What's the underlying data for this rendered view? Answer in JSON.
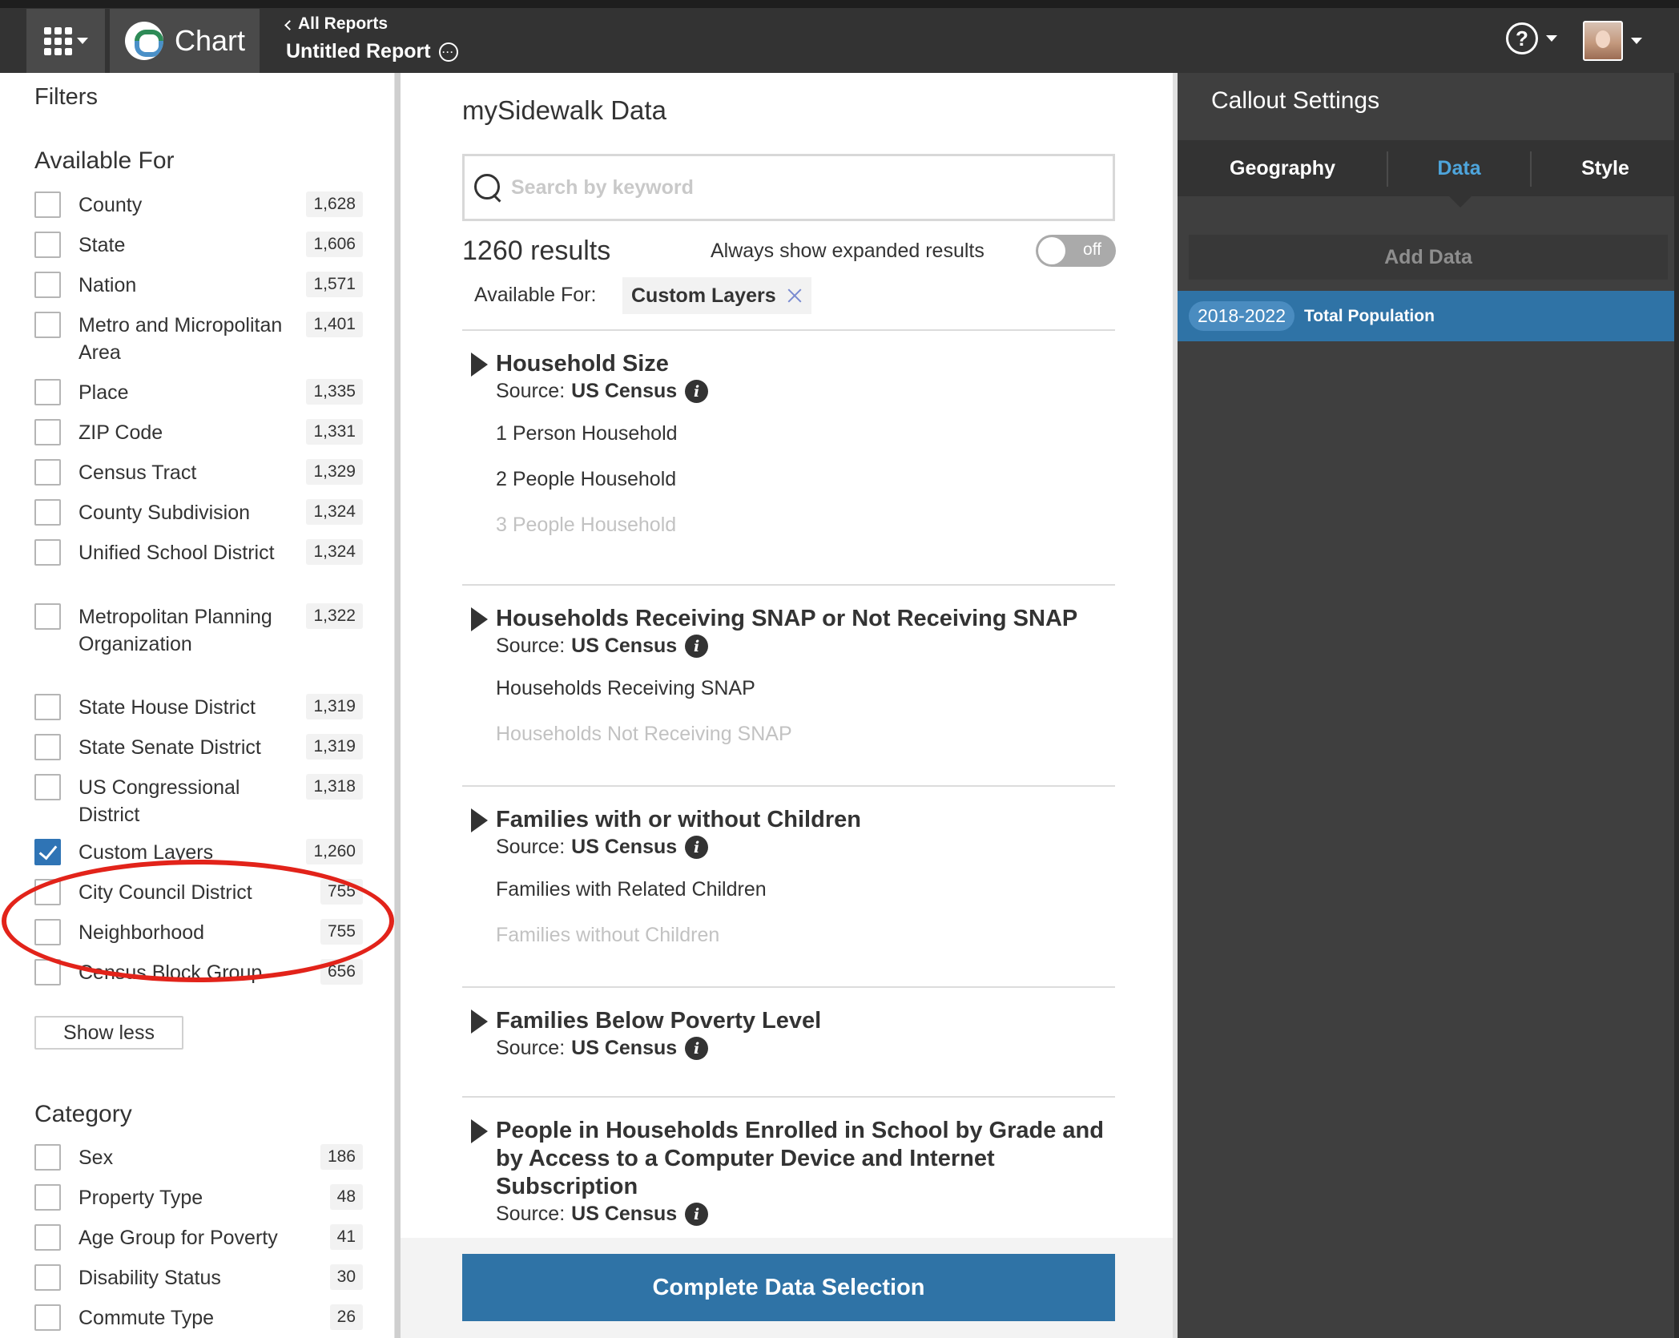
{
  "topbar": {
    "app_name": "Chart",
    "back_link": "All Reports",
    "report_title": "Untitled Report"
  },
  "filters": {
    "title": "Filters",
    "available_for_title": "Available For",
    "available_for": [
      {
        "label": "County",
        "count": "1,628",
        "checked": false
      },
      {
        "label": "State",
        "count": "1,606",
        "checked": false
      },
      {
        "label": "Nation",
        "count": "1,571",
        "checked": false
      },
      {
        "label": "Metro and Micropolitan Area",
        "count": "1,401",
        "checked": false
      },
      {
        "label": "Place",
        "count": "1,335",
        "checked": false
      },
      {
        "label": "ZIP Code",
        "count": "1,331",
        "checked": false
      },
      {
        "label": "Census Tract",
        "count": "1,329",
        "checked": false
      },
      {
        "label": "County Subdivision",
        "count": "1,324",
        "checked": false
      },
      {
        "label": "Unified School District",
        "count": "1,324",
        "checked": false
      },
      {
        "label": "Metropolitan Planning Organization",
        "count": "1,322",
        "checked": false
      },
      {
        "label": "State House District",
        "count": "1,319",
        "checked": false
      },
      {
        "label": "State Senate District",
        "count": "1,319",
        "checked": false
      },
      {
        "label": "US Congressional District",
        "count": "1,318",
        "checked": false
      },
      {
        "label": "Custom Layers",
        "count": "1,260",
        "checked": true
      },
      {
        "label": "City Council District",
        "count": "755",
        "checked": false
      },
      {
        "label": "Neighborhood",
        "count": "755",
        "checked": false
      },
      {
        "label": "Census Block Group",
        "count": "656",
        "checked": false
      }
    ],
    "show_less_label": "Show less",
    "category_title": "Category",
    "category": [
      {
        "label": "Sex",
        "count": "186",
        "checked": false
      },
      {
        "label": "Property Type",
        "count": "48",
        "checked": false
      },
      {
        "label": "Age Group for Poverty",
        "count": "41",
        "checked": false
      },
      {
        "label": "Disability Status",
        "count": "30",
        "checked": false
      },
      {
        "label": "Commute Type",
        "count": "26",
        "checked": false
      }
    ]
  },
  "center": {
    "title": "mySidewalk Data",
    "search_placeholder": "Search by keyword",
    "results_count": "1260 results",
    "expand_label": "Always show expanded results",
    "toggle_state": "off",
    "available_for_label": "Available For:",
    "active_filter_chip": "Custom Layers",
    "source_label": "Source:",
    "groups": [
      {
        "title": "Household Size",
        "source": "US Census",
        "items": [
          {
            "label": "1 Person Household",
            "faded": false
          },
          {
            "label": "2 People Household",
            "faded": false
          },
          {
            "label": "3 People Household",
            "faded": true
          }
        ]
      },
      {
        "title": "Households Receiving SNAP or Not Receiving SNAP",
        "source": "US Census",
        "items": [
          {
            "label": "Households Receiving SNAP",
            "faded": false
          },
          {
            "label": "Households Not Receiving SNAP",
            "faded": true
          }
        ]
      },
      {
        "title": "Families with or without Children",
        "source": "US Census",
        "items": [
          {
            "label": "Families with Related Children",
            "faded": false
          },
          {
            "label": "Families without Children",
            "faded": true
          }
        ]
      },
      {
        "title": "Families Below Poverty Level",
        "source": "US Census",
        "items": []
      },
      {
        "title": "People in Households Enrolled in School by Grade and by Access to a Computer Device and Internet Subscription",
        "source": "US Census",
        "items": []
      }
    ],
    "complete_button": "Complete Data Selection"
  },
  "callout": {
    "title": "Callout Settings",
    "tabs": [
      "Geography",
      "Data",
      "Style"
    ],
    "active_tab": "Data",
    "add_data_label": "Add Data",
    "selected_data": {
      "year": "2018-2022",
      "name": "Total Population"
    }
  },
  "colors": {
    "accent_blue": "#2f73a6",
    "active_tab": "#4ea5dc",
    "highlight_circle": "#e2231a"
  },
  "icons": [
    "apps-grid-icon",
    "chart-logo-icon",
    "chevron-left-icon",
    "more-options-icon",
    "help-icon",
    "avatar",
    "search-icon",
    "close-icon",
    "expand-triangle-icon",
    "info-icon",
    "checkbox-check-icon"
  ]
}
